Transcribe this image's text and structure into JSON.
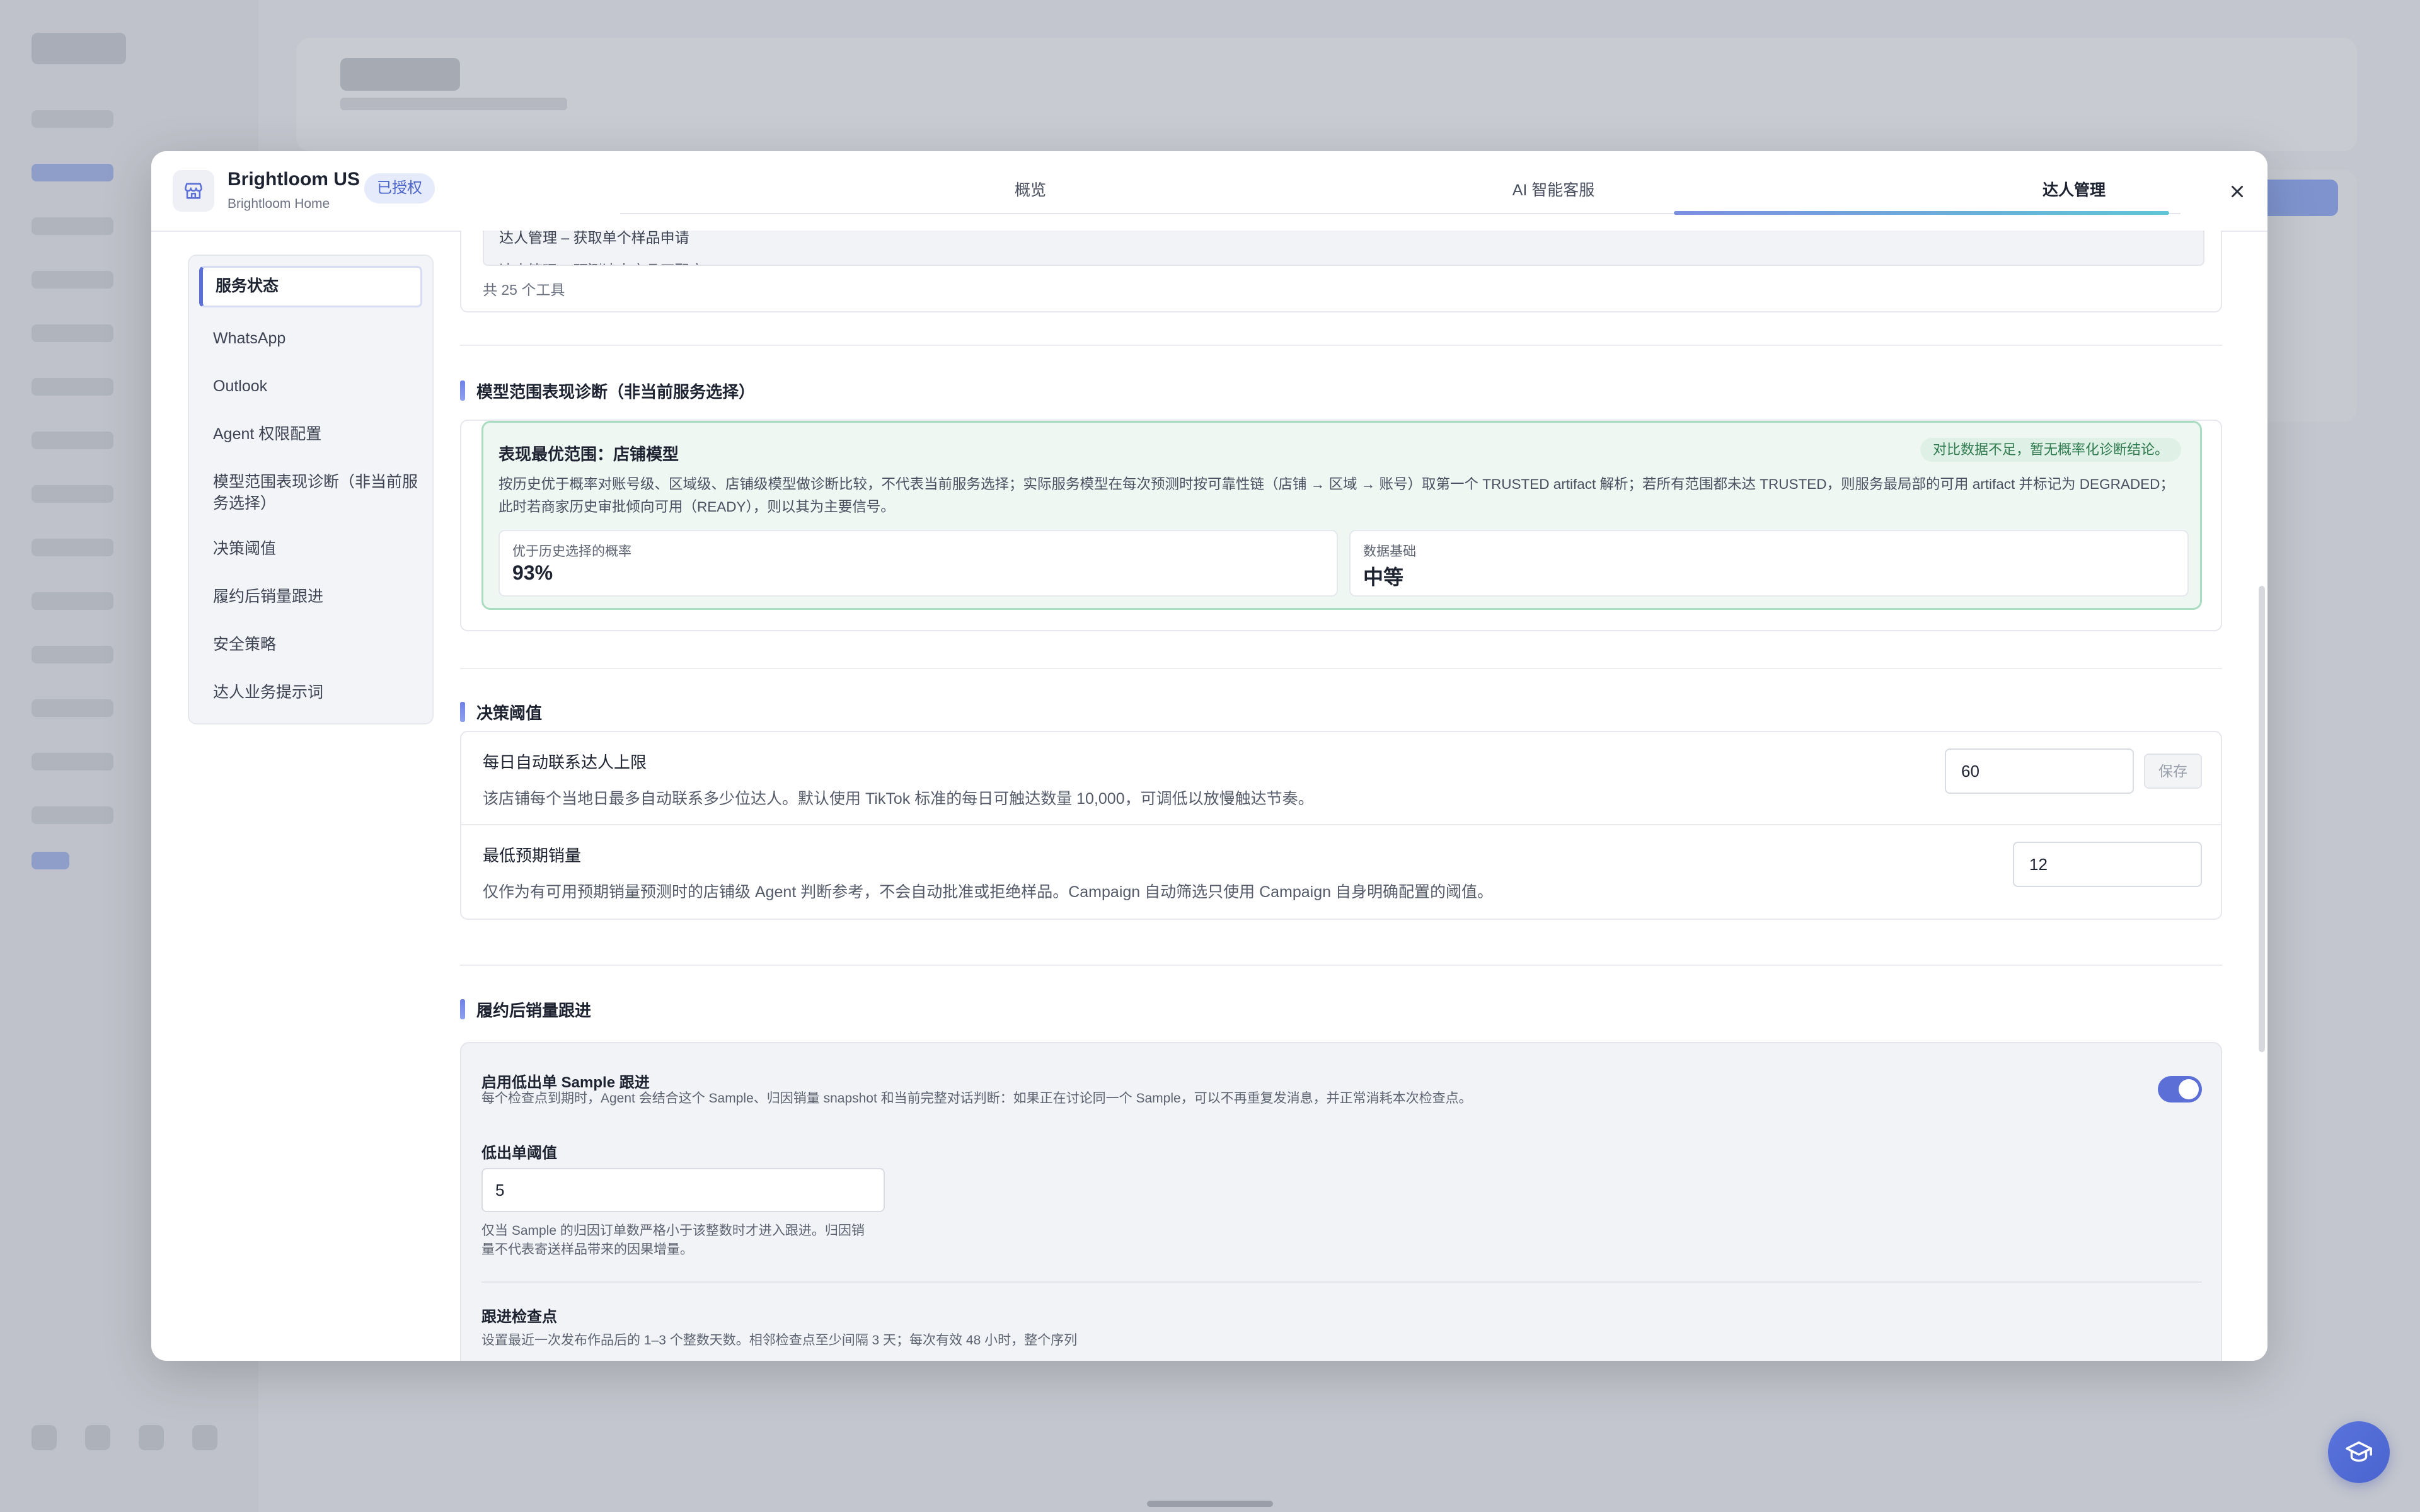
{
  "modal": {
    "store_name": "Brightloom US",
    "store_sub": "Brightloom Home",
    "auth_badge": "已授权",
    "tabs": [
      {
        "label": "概览",
        "active": false
      },
      {
        "label": "AI 智能客服",
        "active": false
      },
      {
        "label": "达人管理",
        "active": true
      }
    ]
  },
  "leftnav": {
    "items": [
      {
        "label": "服务状态",
        "active": true
      },
      {
        "label": "WhatsApp",
        "active": false
      },
      {
        "label": "Outlook",
        "active": false
      },
      {
        "label": "Agent 权限配置",
        "active": false
      },
      {
        "label": "模型范围表现诊断（非当前服务选择）",
        "active": false
      },
      {
        "label": "决策阈值",
        "active": false
      },
      {
        "label": "履约后销量跟进",
        "active": false
      },
      {
        "label": "安全策略",
        "active": false
      },
      {
        "label": "达人业务提示词",
        "active": false
      }
    ]
  },
  "tools": {
    "rows": [
      "达人管理 – 获取单个样品申请",
      "达人管理 – 预测达人产品匹配度"
    ],
    "count_text": "共 25 个工具"
  },
  "diagnosis": {
    "section_title": "模型范围表现诊断（非当前服务选择）",
    "title": "表现最优范围：店铺模型",
    "badge": "对比数据不足，暂无概率化诊断结论。",
    "desc": "按历史优于概率对账号级、区域级、店铺级模型做诊断比较，不代表当前服务选择；实际服务模型在每次预测时按可靠性链（店铺 → 区域 → 账号）取第一个 TRUSTED artifact 解析；若所有范围都未达 TRUSTED，则服务最局部的可用 artifact 并标记为 DEGRADED；此时若商家历史审批倾向可用（READY），则以其为主要信号。",
    "metrics": [
      {
        "label": "优于历史选择的概率",
        "value": "93%"
      },
      {
        "label": "数据基础",
        "value": "中等"
      }
    ]
  },
  "thresholds": {
    "section_title": "决策阈值",
    "daily": {
      "title": "每日自动联系达人上限",
      "desc": "该店铺每个当地日最多自动联系多少位达人。默认使用 TikTok 标准的每日可触达数量 10,000，可调低以放慢触达节奏。",
      "value": "60",
      "save_label": "保存"
    },
    "min_sales": {
      "title": "最低预期销量",
      "desc": "仅作为有可用预期销量预测时的店铺级 Agent 判断参考，不会自动批准或拒绝样品。Campaign 自动筛选只使用 Campaign 自身明确配置的阈值。",
      "value": "12"
    }
  },
  "followup": {
    "section_title": "履约后销量跟进",
    "enable_title": "启用低出单 Sample 跟进",
    "enable_desc": "每个检查点到期时，Agent 会结合这个 Sample、归因销量 snapshot 和当前完整对话判断：如果正在讨论同一个 Sample，可以不再重复发消息，并正常消耗本次检查点。",
    "enabled": true,
    "threshold_label": "低出单阈值",
    "threshold_value": "5",
    "threshold_help_1": "仅当 Sample 的归因订单数严格小于该整数时才进入跟进。归因销",
    "threshold_help_2": "量不代表寄送样品带来的因果增量。",
    "checkpoint_title": "跟进检查点",
    "checkpoint_desc": "设置最近一次发布作品后的 1–3 个整数天数。相邻检查点至少间隔 3 天；每次有效 48 小时，整个序列"
  }
}
